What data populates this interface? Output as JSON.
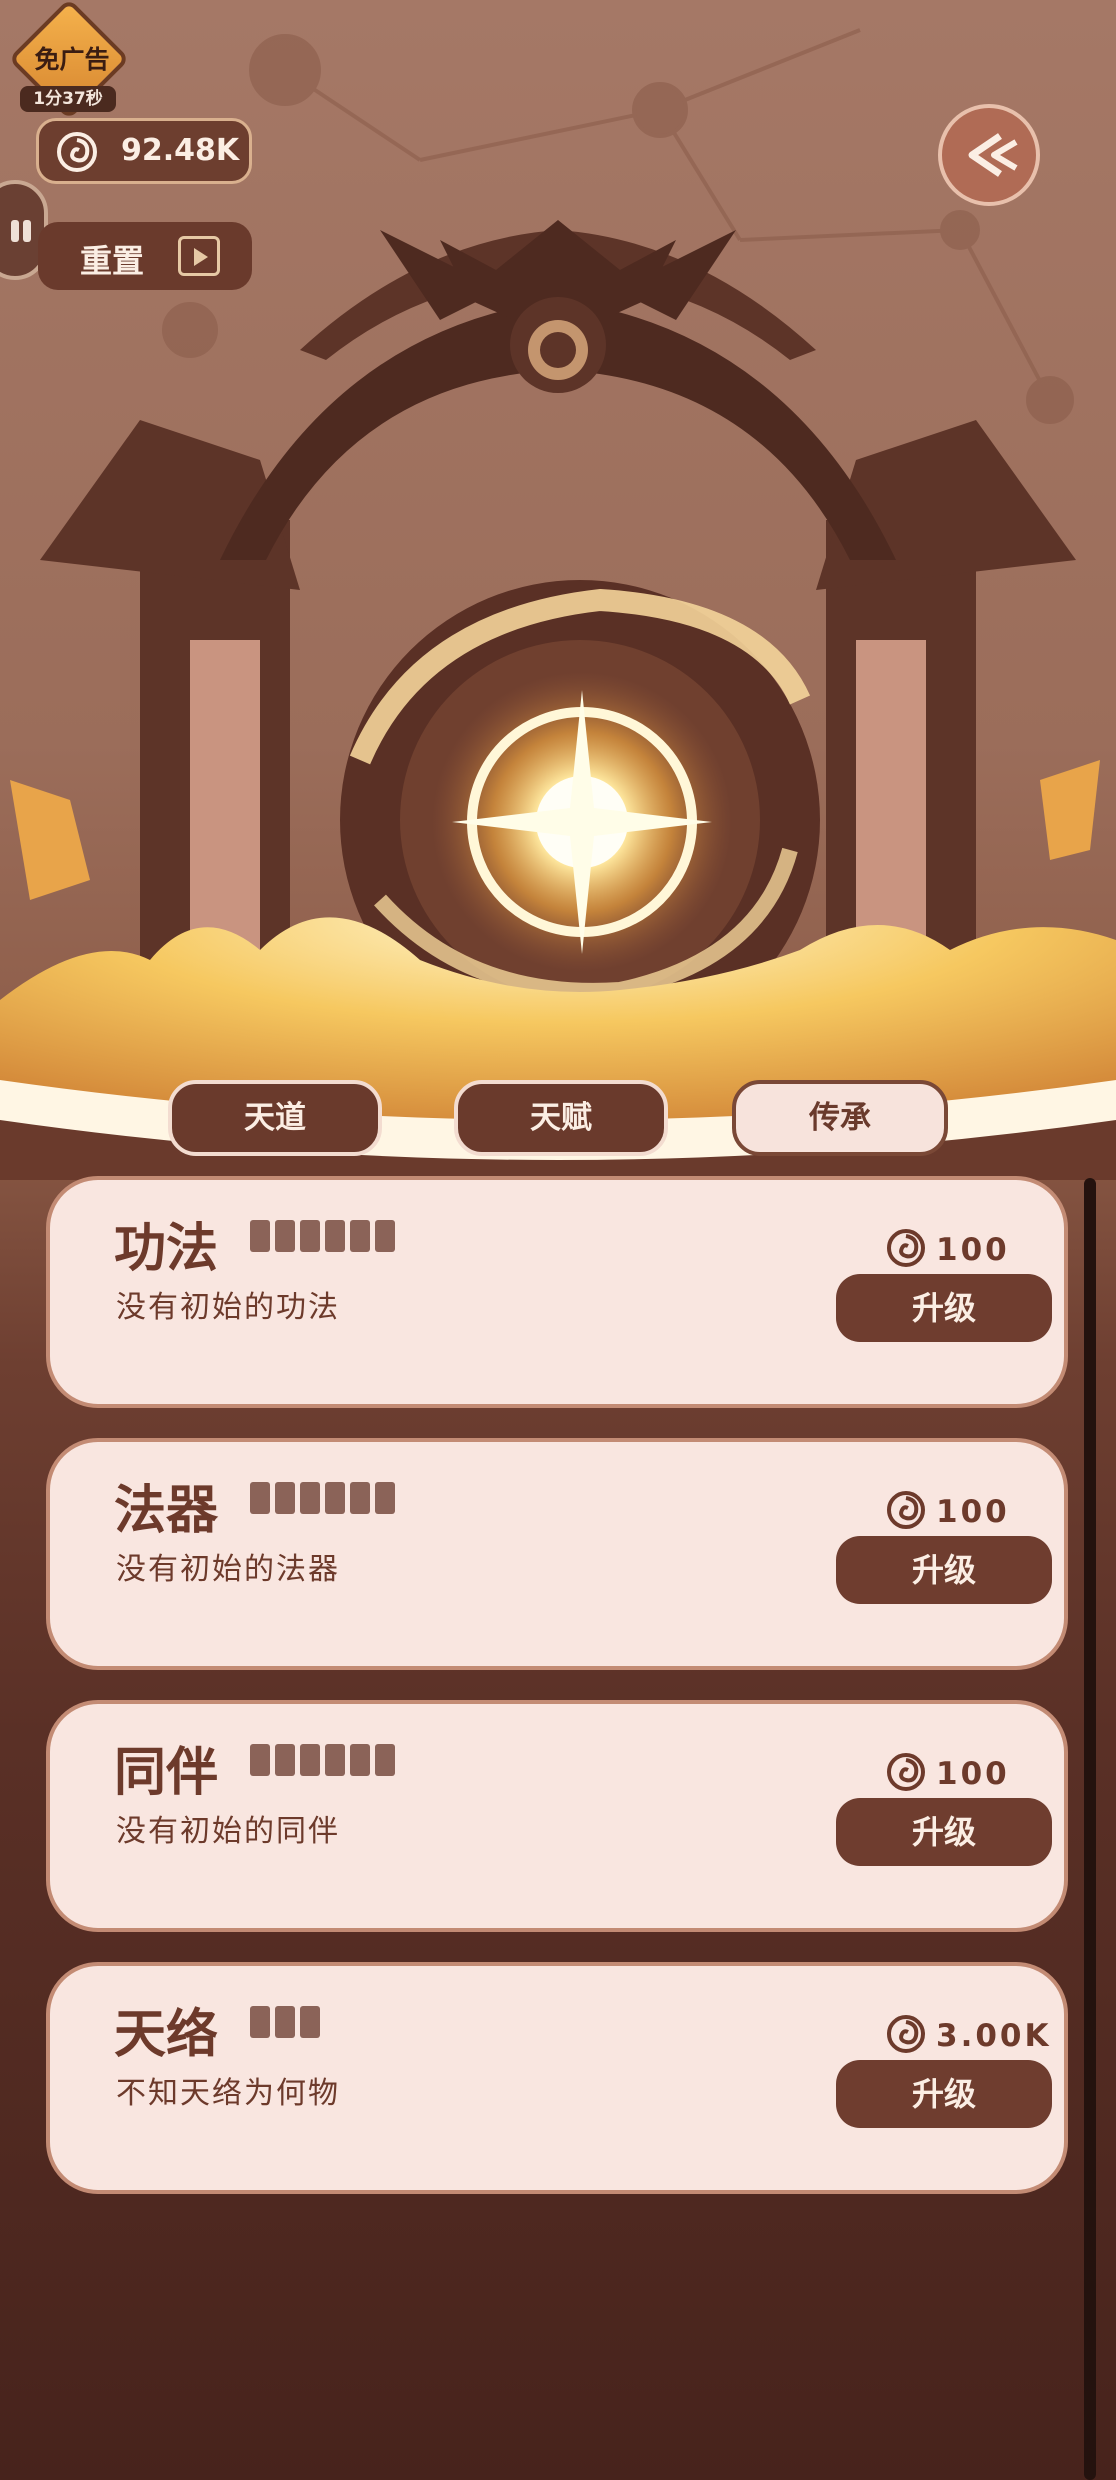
{
  "hud": {
    "ad_label": "免广告",
    "ad_timer": "1分37秒",
    "currency_value": "92.48K",
    "reset_label": "重置",
    "icons": {
      "currency": "spiral-coin-icon",
      "video": "video-play-icon",
      "back": "double-chevron-left-icon",
      "side": "pause-icon"
    }
  },
  "tabs": [
    {
      "label": "天道",
      "active": false
    },
    {
      "label": "天赋",
      "active": false
    },
    {
      "label": "传承",
      "active": true
    }
  ],
  "cards": [
    {
      "title": "功法",
      "pips": 6,
      "desc": "没有初始的功法",
      "cost": "100",
      "button": "升级"
    },
    {
      "title": "法器",
      "pips": 6,
      "desc": "没有初始的法器",
      "cost": "100",
      "button": "升级"
    },
    {
      "title": "同伴",
      "pips": 6,
      "desc": "没有初始的同伴",
      "cost": "100",
      "button": "升级"
    },
    {
      "title": "天络",
      "pips": 3,
      "desc": "不知天络为何物",
      "cost": "3.00K",
      "button": "升级"
    }
  ],
  "colors": {
    "accent": "#6f3d2f",
    "card_bg": "#f9e6e0",
    "glow": "#fff3c4"
  }
}
